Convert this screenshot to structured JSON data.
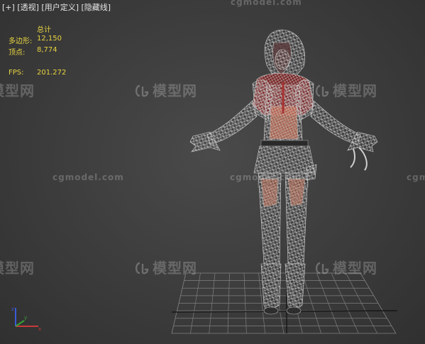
{
  "viewport_menu": {
    "plus": "[+]",
    "view": "[透视]",
    "shading": "[用户定义]",
    "display": "[隐藏线]"
  },
  "stats": {
    "header": "总计",
    "polygons_label": "多边形:",
    "polygons_value": "12,150",
    "vertices_label": "顶点:",
    "vertices_value": "8,774",
    "fps_label": "FPS:",
    "fps_value": "201.272"
  },
  "watermark": {
    "url": "cgmodel.com",
    "brand": "模型网"
  },
  "colors": {
    "stats_text": "#e8d440",
    "grid": "#8a8a8a",
    "wireframe": "#c4c4c4",
    "accent_red": "#c24a4a",
    "accent_orange": "#e07050"
  },
  "icons": [
    "plus-icon",
    "axis-gizmo-icon",
    "wireframe-character",
    "ground-grid"
  ]
}
